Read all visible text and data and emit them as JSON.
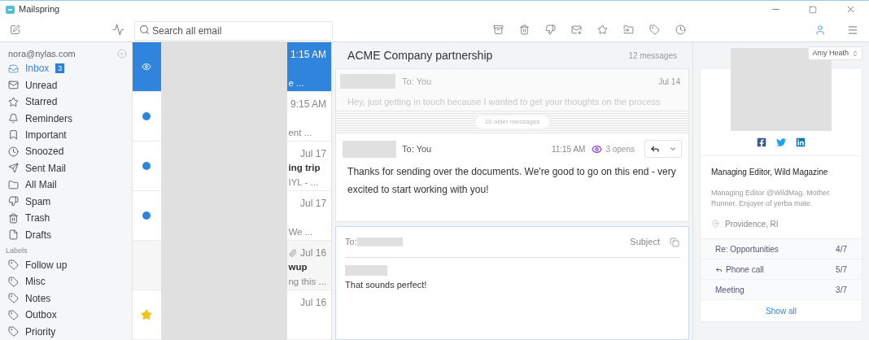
{
  "window": {
    "title": "Mailspring"
  },
  "search": {
    "placeholder": "Search all email"
  },
  "account": {
    "email": "nora@nylas.com"
  },
  "folders": [
    {
      "label": "Inbox",
      "selected": true,
      "count": "3"
    },
    {
      "label": "Unread",
      "selected": false
    },
    {
      "label": "Starred",
      "selected": false
    },
    {
      "label": "Reminders",
      "selected": false
    },
    {
      "label": "Important",
      "selected": false
    },
    {
      "label": "Snoozed",
      "selected": false
    },
    {
      "label": "Sent Mail",
      "selected": false
    },
    {
      "label": "All Mail",
      "selected": false
    },
    {
      "label": "Spam",
      "selected": false
    },
    {
      "label": "Trash",
      "selected": false
    },
    {
      "label": "Drafts",
      "selected": false
    }
  ],
  "labels_heading": "Labels",
  "labels": [
    {
      "label": "Follow up",
      "selected": false
    },
    {
      "label": "Misc",
      "selected": false
    },
    {
      "label": "Notes",
      "selected": false
    },
    {
      "label": "Outbox",
      "selected": false
    },
    {
      "label": "Priority",
      "selected": false
    }
  ],
  "threads": [
    {
      "kind": "tracked",
      "selected": true,
      "attachment": false,
      "time": "1:15 AM",
      "snippet": "e ..."
    },
    {
      "kind": "plain",
      "selected": false,
      "unread": true,
      "attachment": false,
      "time": "9:15 AM",
      "snippet": "ent ..."
    },
    {
      "kind": "plain",
      "selected": false,
      "unread": true,
      "attachment": false,
      "time": "Jul 17",
      "subject": "ing trip",
      "snippet": "IYL - ..."
    },
    {
      "kind": "plain",
      "selected": false,
      "unread": true,
      "attachment": false,
      "time": "Jul 17",
      "snippet": "We ..."
    },
    {
      "kind": "plain",
      "selected": false,
      "unread": false,
      "attachment": true,
      "time": "Jul 16",
      "subject": "wup",
      "snippet": "ng this ..."
    },
    {
      "kind": "starred",
      "selected": false,
      "unread": true,
      "attachment": false,
      "time": "Jul 16"
    }
  ],
  "conversation": {
    "subject": "ACME Company partnership",
    "count": "12 messages",
    "collapsed": {
      "to": "To: You",
      "date": "Jul 14",
      "snippet": "Hey, just getting in touch because I wanted to get your thoughts on the process"
    },
    "older": "10 older messages",
    "message": {
      "to": "To: You",
      "time": "11:15 AM",
      "opens": "3 opens",
      "body": "Thanks for sending over the documents. We're good to go on this end - very excited to start working with you!"
    },
    "composer": {
      "to_label": "To:",
      "subject_placeholder": "Subject",
      "body": "That sounds perfect!"
    }
  },
  "contact": {
    "name": "Amy Heath",
    "title": "Managing Editor, Wild Magazine",
    "bio": "Managing Editor @WildMag. Mother. Runner. Enjoyer of yerba mate.",
    "location": "Providence, RI",
    "threads": [
      {
        "subject": "Re: Opportunities",
        "count": "4/7",
        "replied": false
      },
      {
        "subject": "Phone call",
        "count": "5/7",
        "replied": true
      },
      {
        "subject": "Meeting",
        "count": "3/7",
        "replied": false
      }
    ],
    "show_all": "Show all"
  }
}
